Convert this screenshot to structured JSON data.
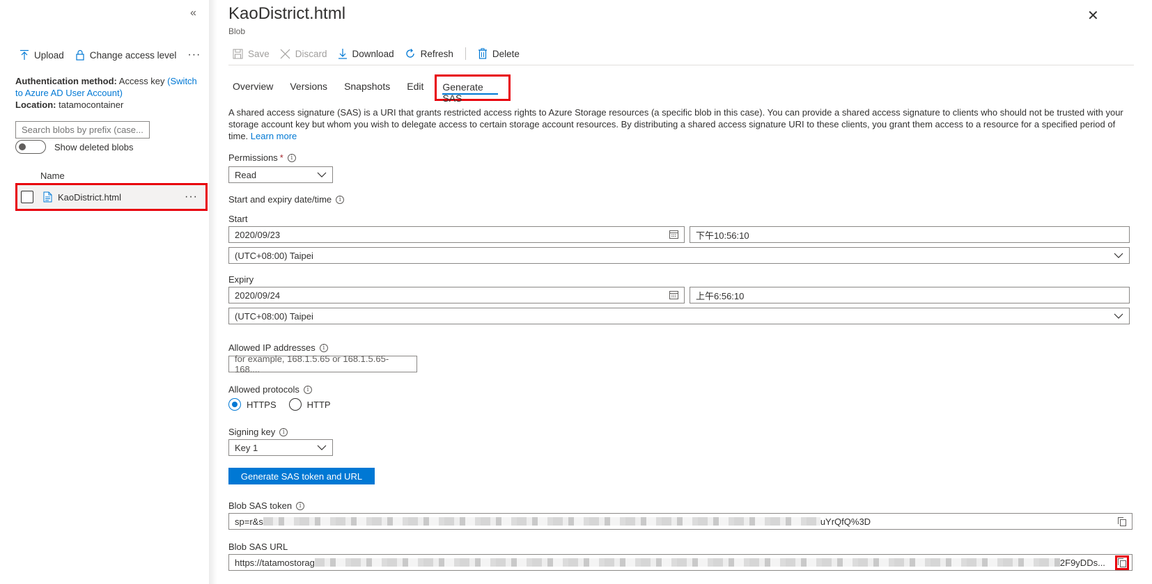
{
  "left": {
    "collapse_glyph": "«",
    "toolbar": {
      "upload": "Upload",
      "change_access": "Change access level",
      "more": "···"
    },
    "auth": {
      "method_label": "Authentication method:",
      "method_value": "Access key",
      "switch_link": "(Switch to Azure AD User Account)",
      "location_label": "Location:",
      "location_value": "tatamocontainer"
    },
    "search": {
      "placeholder": "Search blobs by prefix (case..."
    },
    "show_deleted": "Show deleted blobs",
    "list": {
      "column_name": "Name",
      "items": [
        {
          "name": "KaoDistrict.html",
          "more": "···"
        }
      ]
    }
  },
  "panel": {
    "title": "KaoDistrict.html",
    "subtitle": "Blob",
    "close_glyph": "✕",
    "toolbar": {
      "save": "Save",
      "discard": "Discard",
      "download": "Download",
      "refresh": "Refresh",
      "delete": "Delete"
    },
    "tabs": [
      "Overview",
      "Versions",
      "Snapshots",
      "Edit",
      "Generate SAS"
    ],
    "active_tab": "Generate SAS",
    "description": "A shared access signature (SAS) is a URI that grants restricted access rights to Azure Storage resources (a specific blob in this case). You can provide a shared access signature to clients who should not be trusted with your storage account key but whom you wish to delegate access to certain storage account resources. By distributing a shared access signature URI to these clients, you grant them access to a resource for a specified period of time.",
    "learn_more": "Learn more",
    "permissions": {
      "label": "Permissions",
      "required": "*",
      "value": "Read"
    },
    "start_expiry_label": "Start and expiry date/time",
    "start": {
      "label": "Start",
      "date": "2020/09/23",
      "time": "下午10:56:10",
      "timezone": "(UTC+08:00) Taipei"
    },
    "expiry": {
      "label": "Expiry",
      "date": "2020/09/24",
      "time": "上午6:56:10",
      "timezone": "(UTC+08:00) Taipei"
    },
    "allowed_ip": {
      "label": "Allowed IP addresses",
      "placeholder": "for example, 168.1.5.65 or 168.1.5.65-168...."
    },
    "protocols": {
      "label": "Allowed protocols",
      "options": [
        "HTTPS",
        "HTTP"
      ],
      "selected": "HTTPS"
    },
    "signing_key": {
      "label": "Signing key",
      "value": "Key 1"
    },
    "generate_button": "Generate SAS token and URL",
    "sas_token": {
      "label": "Blob SAS token",
      "prefix": "sp=r&s",
      "suffix": "uYrQfQ%3D"
    },
    "sas_url": {
      "label": "Blob SAS URL",
      "prefix": "https://tatamostorag",
      "suffix": "2F9yDDs..."
    }
  },
  "colors": {
    "accent": "#0078d4",
    "highlight": "#e8000b",
    "text": "#323130",
    "disabled": "#a19f9d"
  }
}
